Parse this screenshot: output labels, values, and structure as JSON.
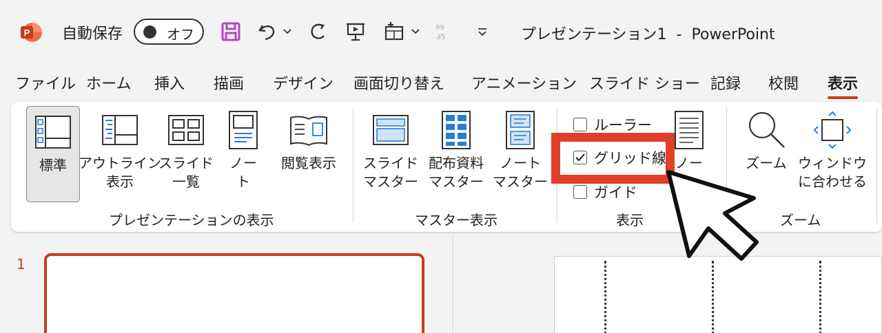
{
  "titlebar": {
    "autosave_label": "自動保存",
    "autosave_state": "オフ",
    "document_title": "プレゼンテーション1  -  PowerPoint",
    "logo_letter": "P",
    "brand_color": "#c43e1c"
  },
  "tabs": [
    {
      "label": "ファイル"
    },
    {
      "label": "ホーム"
    },
    {
      "label": "挿入"
    },
    {
      "label": "描画"
    },
    {
      "label": "デザイン"
    },
    {
      "label": "画面切り替え"
    },
    {
      "label": "アニメーション"
    },
    {
      "label": "スライド ショー"
    },
    {
      "label": "記録"
    },
    {
      "label": "校閲"
    },
    {
      "label": "表示",
      "active": true
    }
  ],
  "ribbon": {
    "presentation_views": {
      "group_label": "プレゼンテーションの表示",
      "normal": "標準",
      "outline_l1": "アウトライン",
      "outline_l2": "表示",
      "slide_sorter_l1": "スライド",
      "slide_sorter_l2": "一覧",
      "notes_page_l1": "ノー",
      "notes_page_l2": "ト",
      "reading_view": "閲覧表示"
    },
    "master_views": {
      "group_label": "マスター表示",
      "slide_master_l1": "スライド",
      "slide_master_l2": "マスター",
      "handout_master_l1": "配布資料",
      "handout_master_l2": "マスター",
      "notes_master_l1": "ノート",
      "notes_master_l2": "マスター"
    },
    "show": {
      "group_label": "表示",
      "ruler": "ルーラー",
      "ruler_checked": false,
      "gridlines": "グリッド線",
      "gridlines_checked": true,
      "guides": "ガイド",
      "guides_checked": false,
      "notes": "ノー"
    },
    "zoom": {
      "group_label": "ズーム",
      "zoom": "ズーム",
      "fit_l1": "ウィンドウ",
      "fit_l2": "に合わせる"
    }
  },
  "slides": {
    "thumbnail_number": "1"
  }
}
